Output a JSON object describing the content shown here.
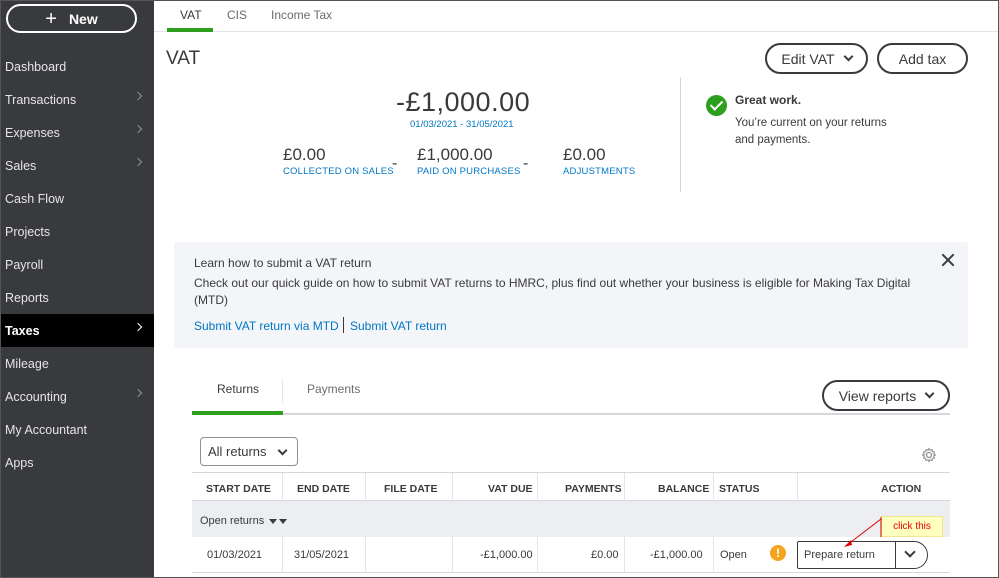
{
  "sidebar": {
    "new_label": "New",
    "items": [
      {
        "label": "Dashboard"
      },
      {
        "label": "Transactions"
      },
      {
        "label": "Expenses"
      },
      {
        "label": "Sales"
      },
      {
        "label": "Cash Flow"
      },
      {
        "label": "Projects"
      },
      {
        "label": "Payroll"
      },
      {
        "label": "Reports"
      },
      {
        "label": "Taxes"
      },
      {
        "label": "Mileage"
      },
      {
        "label": "Accounting"
      },
      {
        "label": "My Accountant"
      },
      {
        "label": "Apps"
      }
    ]
  },
  "tabs": [
    {
      "label": "VAT"
    },
    {
      "label": "CIS"
    },
    {
      "label": "Income Tax"
    }
  ],
  "header": {
    "title": "VAT",
    "edit_vat_label": "Edit VAT",
    "add_tax_label": "Add tax"
  },
  "summary": {
    "total": "-£1,000.00",
    "period": "01/03/2021 - 31/05/2021",
    "collected_value": "£0.00",
    "collected_label": "COLLECTED ON SALES",
    "paid_value": "£1,000.00",
    "paid_label": "PAID ON PURCHASES",
    "adjust_value": "£0.00",
    "adjust_label": "ADJUSTMENTS",
    "minus": "-"
  },
  "status_panel": {
    "title": "Great work.",
    "message": "You’re current on your returns and payments."
  },
  "banner": {
    "title": "Learn how to submit a VAT return",
    "text": "Check out our quick guide on how to submit VAT returns to HMRC, plus find out whether your business is eligible for Making Tax Digital (MTD)",
    "link1": "Submit VAT return via MTD",
    "link2": "Submit VAT return"
  },
  "returns_section": {
    "tabs": [
      {
        "label": "Returns"
      },
      {
        "label": "Payments"
      }
    ],
    "view_reports_label": "View reports",
    "filter_value": "All returns",
    "columns": [
      "START DATE",
      "END DATE",
      "FILE DATE",
      "VAT DUE",
      "PAYMENTS",
      "BALANCE",
      "STATUS",
      "ACTION"
    ],
    "group_label": "Open returns",
    "rows": [
      {
        "start": "01/03/2021",
        "end": "31/05/2021",
        "file": "",
        "vat_due": "-£1,000.00",
        "payments": "£0.00",
        "balance": "-£1,000.00",
        "status": "Open",
        "action_label": "Prepare return"
      }
    ]
  },
  "annotation": {
    "text": "click this",
    "color": "#e00000"
  },
  "colors": {
    "accent_green": "#2ca01c",
    "link_blue": "#0077c5",
    "sidebar_bg": "#393a3d",
    "warning": "#f4a51d"
  }
}
